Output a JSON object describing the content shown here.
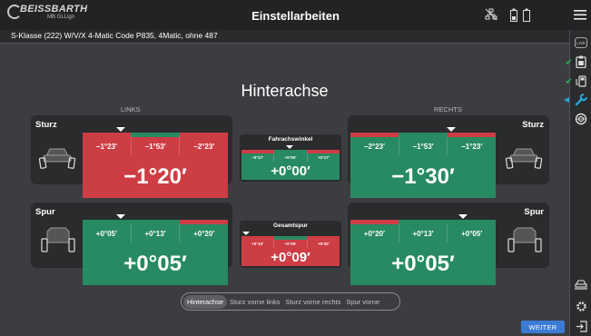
{
  "header": {
    "logo_brand": "BEISSBARTH",
    "logo_sub": "MB GLLign",
    "title": "Einstellarbeiten",
    "vehicle": "S-Klasse (222) W/V/X 4-Matic Code P835, 4Matic, ohne 487"
  },
  "main": {
    "title": "Hinterachse",
    "left_label": "LINKS",
    "right_label": "RECHTS"
  },
  "sturz": {
    "label": "Sturz",
    "left": {
      "min": "−1°23′",
      "nom": "−1°53′",
      "max": "−2°23′",
      "value": "−1°20′",
      "status": "out"
    },
    "right": {
      "min": "−2°23′",
      "nom": "−1°53′",
      "max": "−1°23′",
      "value": "−1°30′",
      "status": "ok"
    }
  },
  "fahrachswinkel": {
    "label": "Fahrachswinkel",
    "min": "−0°17′",
    "nom": "+0°00′",
    "max": "+0°17′",
    "value": "+0°00′",
    "status": "ok"
  },
  "spur": {
    "label": "Spur",
    "left": {
      "min": "+0°05′",
      "nom": "+0°13′",
      "max": "+0°20′",
      "value": "+0°05′",
      "status": "ok"
    },
    "right": {
      "min": "+0°20′",
      "nom": "+0°13′",
      "max": "+0°05′",
      "value": "+0°05′",
      "status": "ok"
    }
  },
  "gesamtspur": {
    "label": "Gesamtspur",
    "min": "+0°10′",
    "nom": "+0°25′",
    "max": "+0°32′",
    "value": "+0°09′",
    "status": "out"
  },
  "tabs": [
    {
      "label": "Hinterachse",
      "active": true
    },
    {
      "label": "Sturz vorne links",
      "active": false
    },
    {
      "label": "Sturz vorne rechts",
      "active": false
    },
    {
      "label": "Spur vorne",
      "active": false
    }
  ],
  "footer": {
    "next_label": "WEITER"
  },
  "sidebar": {
    "live_label": "LIVE"
  },
  "colors": {
    "ok": "#288a63",
    "out": "#cd3d44",
    "accent": "#3a7bd5",
    "check": "#2fbf6a",
    "active_tool": "#2aa6d8"
  },
  "icons": [
    "logo-ring",
    "network-disconnected-icon",
    "battery-icon",
    "battery-icon",
    "menu-icon",
    "live-icon",
    "clipboard-icon",
    "fuel-icon",
    "wrench-icon",
    "tire-icon",
    "car-lift-icon",
    "settings-icon",
    "logout-icon",
    "car-front-icon",
    "car-rear-icon"
  ]
}
